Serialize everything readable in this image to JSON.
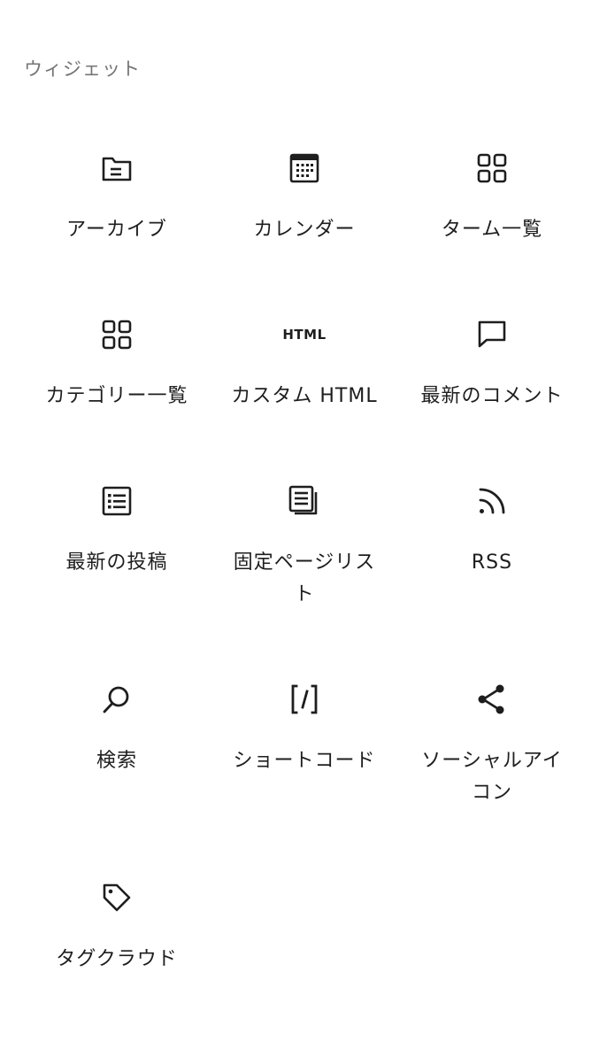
{
  "section": {
    "title": "ウィジェット"
  },
  "blocks": [
    {
      "label": "アーカイブ",
      "icon": "archive-folder-icon"
    },
    {
      "label": "カレンダー",
      "icon": "calendar-icon"
    },
    {
      "label": "ターム一覧",
      "icon": "grid-icon"
    },
    {
      "label": "カテゴリー一覧",
      "icon": "grid-icon"
    },
    {
      "label": "カスタム HTML",
      "icon": "html-icon",
      "glyph": "HTML"
    },
    {
      "label": "最新のコメント",
      "icon": "comment-icon"
    },
    {
      "label": "最新の投稿",
      "icon": "post-list-icon"
    },
    {
      "label": "固定ページリスト",
      "icon": "pages-icon"
    },
    {
      "label": "RSS",
      "icon": "rss-icon"
    },
    {
      "label": "検索",
      "icon": "search-icon"
    },
    {
      "label": "ショートコード",
      "icon": "shortcode-icon"
    },
    {
      "label": "ソーシャルアイコン",
      "icon": "share-icon"
    },
    {
      "label": "タグクラウド",
      "icon": "tag-icon"
    }
  ]
}
